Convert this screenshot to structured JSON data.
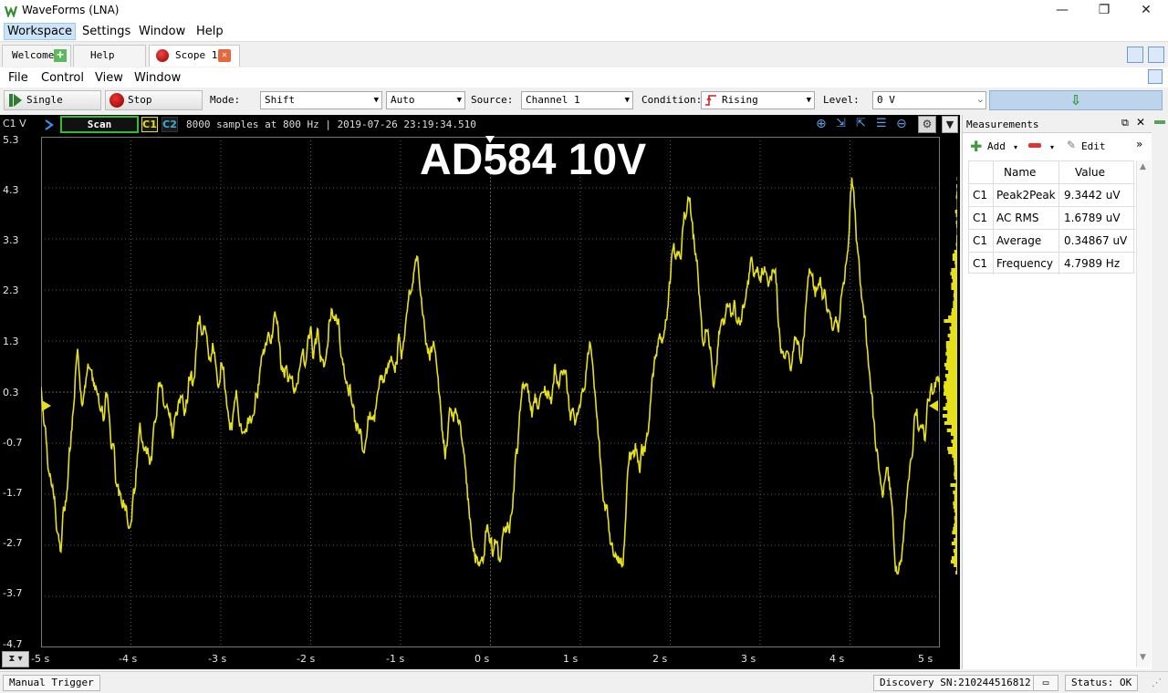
{
  "app": {
    "title": "WaveForms (LNA)"
  },
  "menubar": [
    "Workspace",
    "Settings",
    "Window",
    "Help"
  ],
  "tabs": {
    "welcome": "Welcome",
    "help": "Help",
    "scope": "Scope 1"
  },
  "scope_menu": [
    "File",
    "Control",
    "View",
    "Window"
  ],
  "toolbar": {
    "single_label": "Single",
    "stop_label": "Stop",
    "mode_label": "Mode:",
    "mode_value": "Shift",
    "trigger_value": "Auto",
    "source_label": "Source:",
    "source_value": "Channel 1",
    "condition_label": "Condition:",
    "condition_value": "Rising",
    "level_label": "Level:",
    "level_value": "0 V"
  },
  "plot": {
    "channel_axis_label": "C1 V",
    "scan_label": "Scan",
    "c1_label": "C1",
    "c2_label": "C2",
    "info_text": "8000 samples at 800 Hz | 2019-07-26 23:19:34.510",
    "overlay_title": "AD584 10V",
    "y_ticks": [
      "5.3",
      "4.3",
      "3.3",
      "2.3",
      "1.3",
      "0.3",
      "-0.7",
      "-1.7",
      "-2.7",
      "-3.7",
      "-4.7"
    ],
    "x_ticks": [
      "-5 s",
      "-4 s",
      "-3 s",
      "-2 s",
      "-1 s",
      "0 s",
      "1 s",
      "2 s",
      "3 s",
      "4 s",
      "5 s"
    ],
    "trace_color": "#e6e01a",
    "grid_color": "#5a5a5a"
  },
  "measurements": {
    "panel_title": "Measurements",
    "add_label": "Add",
    "edit_label": "Edit",
    "columns": [
      "Name",
      "Value"
    ],
    "rows": [
      {
        "ch": "C1",
        "name": "Peak2Peak",
        "value": "9.3442 uV"
      },
      {
        "ch": "C1",
        "name": "AC RMS",
        "value": "1.6789 uV"
      },
      {
        "ch": "C1",
        "name": "Average",
        "value": "0.34867 uV"
      },
      {
        "ch": "C1",
        "name": "Frequency",
        "value": "4.7989 Hz"
      }
    ]
  },
  "statusbar": {
    "manual_trigger": "Manual Trigger",
    "device": "Discovery SN:210244516812",
    "status": "Status: OK"
  }
}
